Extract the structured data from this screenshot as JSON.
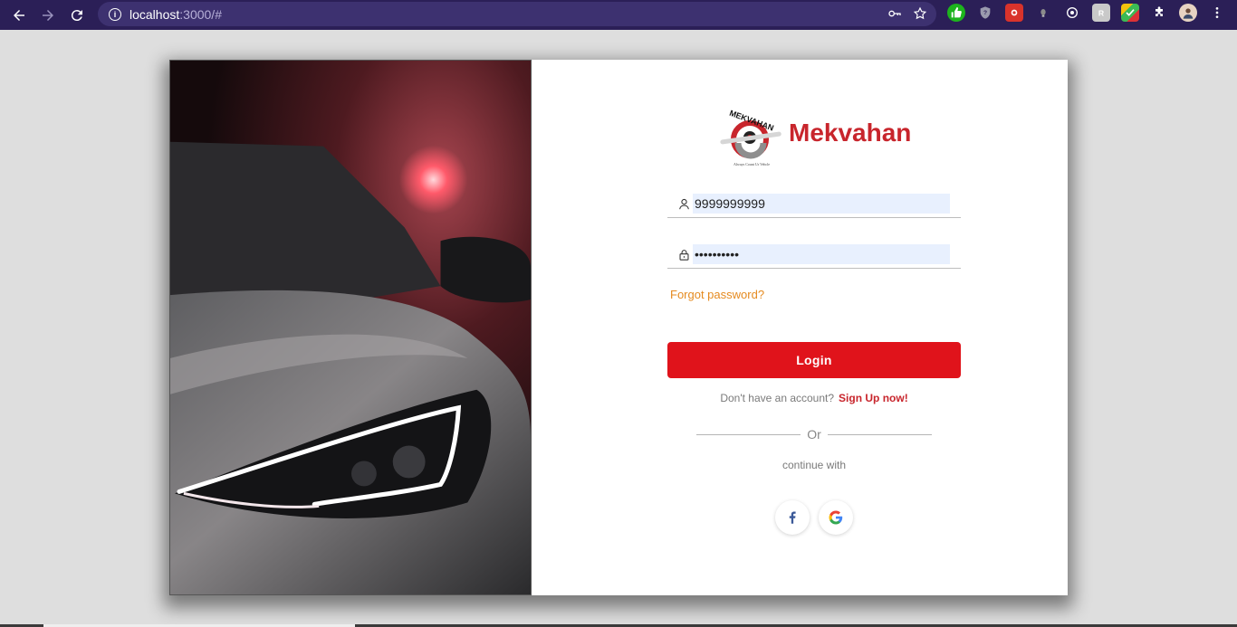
{
  "browser": {
    "url_host": "localhost",
    "url_path": ":3000/#"
  },
  "brand": {
    "name": "Mekvahan",
    "logo_text": "MEKVAHAN",
    "logo_tagline": "Always Count Ur Vehcle"
  },
  "form": {
    "username_value": "9999999999",
    "password_value": "aaaaaaaaaa",
    "forgot_label": "Forgot password?",
    "login_label": "Login",
    "no_account_text": "Don't have an account?",
    "signup_label": "Sign Up now!",
    "or_text": "Or",
    "continue_text": "continue with"
  },
  "colors": {
    "accent": "#e0131b",
    "brand_red": "#c8252c",
    "link_orange": "#e58a1f",
    "chrome_bar": "#2b1f57"
  },
  "icons": {
    "username": "user-icon",
    "password": "lock-icon",
    "social": [
      "facebook-icon",
      "google-icon"
    ]
  }
}
